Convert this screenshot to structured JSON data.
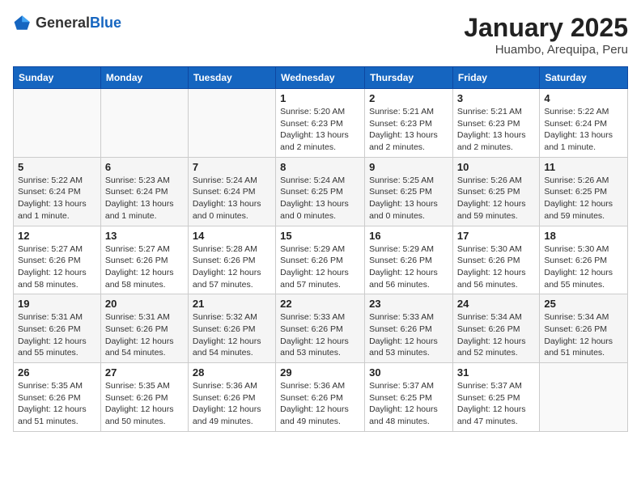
{
  "header": {
    "logo_general": "General",
    "logo_blue": "Blue",
    "month_title": "January 2025",
    "location": "Huambo, Arequipa, Peru"
  },
  "weekdays": [
    "Sunday",
    "Monday",
    "Tuesday",
    "Wednesday",
    "Thursday",
    "Friday",
    "Saturday"
  ],
  "weeks": [
    [
      {
        "day": "",
        "info": ""
      },
      {
        "day": "",
        "info": ""
      },
      {
        "day": "",
        "info": ""
      },
      {
        "day": "1",
        "info": "Sunrise: 5:20 AM\nSunset: 6:23 PM\nDaylight: 13 hours and 2 minutes."
      },
      {
        "day": "2",
        "info": "Sunrise: 5:21 AM\nSunset: 6:23 PM\nDaylight: 13 hours and 2 minutes."
      },
      {
        "day": "3",
        "info": "Sunrise: 5:21 AM\nSunset: 6:23 PM\nDaylight: 13 hours and 2 minutes."
      },
      {
        "day": "4",
        "info": "Sunrise: 5:22 AM\nSunset: 6:24 PM\nDaylight: 13 hours and 1 minute."
      }
    ],
    [
      {
        "day": "5",
        "info": "Sunrise: 5:22 AM\nSunset: 6:24 PM\nDaylight: 13 hours and 1 minute."
      },
      {
        "day": "6",
        "info": "Sunrise: 5:23 AM\nSunset: 6:24 PM\nDaylight: 13 hours and 1 minute."
      },
      {
        "day": "7",
        "info": "Sunrise: 5:24 AM\nSunset: 6:24 PM\nDaylight: 13 hours and 0 minutes."
      },
      {
        "day": "8",
        "info": "Sunrise: 5:24 AM\nSunset: 6:25 PM\nDaylight: 13 hours and 0 minutes."
      },
      {
        "day": "9",
        "info": "Sunrise: 5:25 AM\nSunset: 6:25 PM\nDaylight: 13 hours and 0 minutes."
      },
      {
        "day": "10",
        "info": "Sunrise: 5:26 AM\nSunset: 6:25 PM\nDaylight: 12 hours and 59 minutes."
      },
      {
        "day": "11",
        "info": "Sunrise: 5:26 AM\nSunset: 6:25 PM\nDaylight: 12 hours and 59 minutes."
      }
    ],
    [
      {
        "day": "12",
        "info": "Sunrise: 5:27 AM\nSunset: 6:26 PM\nDaylight: 12 hours and 58 minutes."
      },
      {
        "day": "13",
        "info": "Sunrise: 5:27 AM\nSunset: 6:26 PM\nDaylight: 12 hours and 58 minutes."
      },
      {
        "day": "14",
        "info": "Sunrise: 5:28 AM\nSunset: 6:26 PM\nDaylight: 12 hours and 57 minutes."
      },
      {
        "day": "15",
        "info": "Sunrise: 5:29 AM\nSunset: 6:26 PM\nDaylight: 12 hours and 57 minutes."
      },
      {
        "day": "16",
        "info": "Sunrise: 5:29 AM\nSunset: 6:26 PM\nDaylight: 12 hours and 56 minutes."
      },
      {
        "day": "17",
        "info": "Sunrise: 5:30 AM\nSunset: 6:26 PM\nDaylight: 12 hours and 56 minutes."
      },
      {
        "day": "18",
        "info": "Sunrise: 5:30 AM\nSunset: 6:26 PM\nDaylight: 12 hours and 55 minutes."
      }
    ],
    [
      {
        "day": "19",
        "info": "Sunrise: 5:31 AM\nSunset: 6:26 PM\nDaylight: 12 hours and 55 minutes."
      },
      {
        "day": "20",
        "info": "Sunrise: 5:31 AM\nSunset: 6:26 PM\nDaylight: 12 hours and 54 minutes."
      },
      {
        "day": "21",
        "info": "Sunrise: 5:32 AM\nSunset: 6:26 PM\nDaylight: 12 hours and 54 minutes."
      },
      {
        "day": "22",
        "info": "Sunrise: 5:33 AM\nSunset: 6:26 PM\nDaylight: 12 hours and 53 minutes."
      },
      {
        "day": "23",
        "info": "Sunrise: 5:33 AM\nSunset: 6:26 PM\nDaylight: 12 hours and 53 minutes."
      },
      {
        "day": "24",
        "info": "Sunrise: 5:34 AM\nSunset: 6:26 PM\nDaylight: 12 hours and 52 minutes."
      },
      {
        "day": "25",
        "info": "Sunrise: 5:34 AM\nSunset: 6:26 PM\nDaylight: 12 hours and 51 minutes."
      }
    ],
    [
      {
        "day": "26",
        "info": "Sunrise: 5:35 AM\nSunset: 6:26 PM\nDaylight: 12 hours and 51 minutes."
      },
      {
        "day": "27",
        "info": "Sunrise: 5:35 AM\nSunset: 6:26 PM\nDaylight: 12 hours and 50 minutes."
      },
      {
        "day": "28",
        "info": "Sunrise: 5:36 AM\nSunset: 6:26 PM\nDaylight: 12 hours and 49 minutes."
      },
      {
        "day": "29",
        "info": "Sunrise: 5:36 AM\nSunset: 6:26 PM\nDaylight: 12 hours and 49 minutes."
      },
      {
        "day": "30",
        "info": "Sunrise: 5:37 AM\nSunset: 6:25 PM\nDaylight: 12 hours and 48 minutes."
      },
      {
        "day": "31",
        "info": "Sunrise: 5:37 AM\nSunset: 6:25 PM\nDaylight: 12 hours and 47 minutes."
      },
      {
        "day": "",
        "info": ""
      }
    ]
  ]
}
